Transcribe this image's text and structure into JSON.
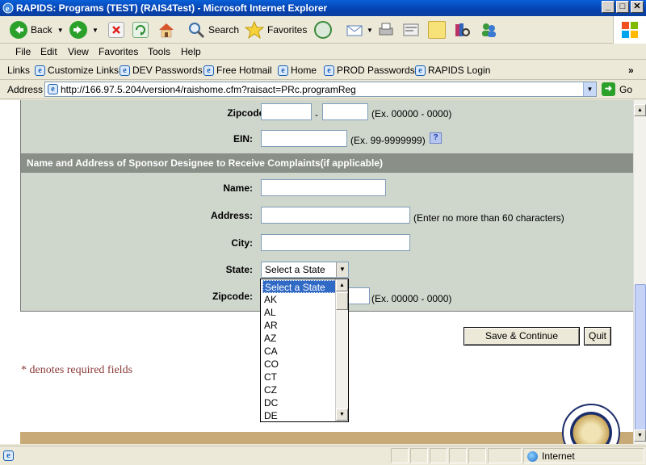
{
  "window": {
    "title": "RAPIDS: Programs  (TEST) (RAIS4Test) - Microsoft Internet Explorer",
    "minimize": "_",
    "maximize": "□",
    "close": "✕"
  },
  "toolbar": {
    "back": "Back",
    "search": "Search",
    "favorites": "Favorites"
  },
  "menu": [
    "File",
    "Edit",
    "View",
    "Favorites",
    "Tools",
    "Help"
  ],
  "links": {
    "label": "Links",
    "items": [
      "Customize Links",
      "DEV Passwords",
      "Free Hotmail",
      "Home",
      "PROD Passwords",
      "RAPIDS Login"
    ],
    "chevron": "»"
  },
  "address": {
    "label": "Address",
    "url": "http://166.97.5.204/version4/raishome.cfm?raisact=PRc.programReg",
    "go": "Go"
  },
  "form": {
    "zipcode_label": "Zipcode:",
    "zip_sep": "-",
    "zip_hint": "(Ex. 00000 - 0000)",
    "ein_label": "EIN:",
    "ein_hint": "(Ex. 99-9999999)",
    "help_icon": "?",
    "section_title": "Name and Address of Sponsor Designee to Receive Complaints(if applicable)",
    "name_label": "Name:",
    "address_label": "Address:",
    "address_hint": "(Enter no more than 60 characters)",
    "city_label": "City:",
    "state_label": "State:",
    "state_selected": "Select a State",
    "zipcode2_label": "Zipcode:",
    "zip2_hint": "(Ex. 00000 - 0000)",
    "required_asterisk": "*"
  },
  "state_options": [
    "Select a State",
    "AK",
    "AL",
    "AR",
    "AZ",
    "CA",
    "CO",
    "CT",
    "CZ",
    "DC",
    "DE"
  ],
  "buttons": {
    "save_continue": "Save & Continue",
    "quit": "Quit"
  },
  "required_note": "* denotes required fields",
  "status": {
    "zone": "Internet"
  }
}
